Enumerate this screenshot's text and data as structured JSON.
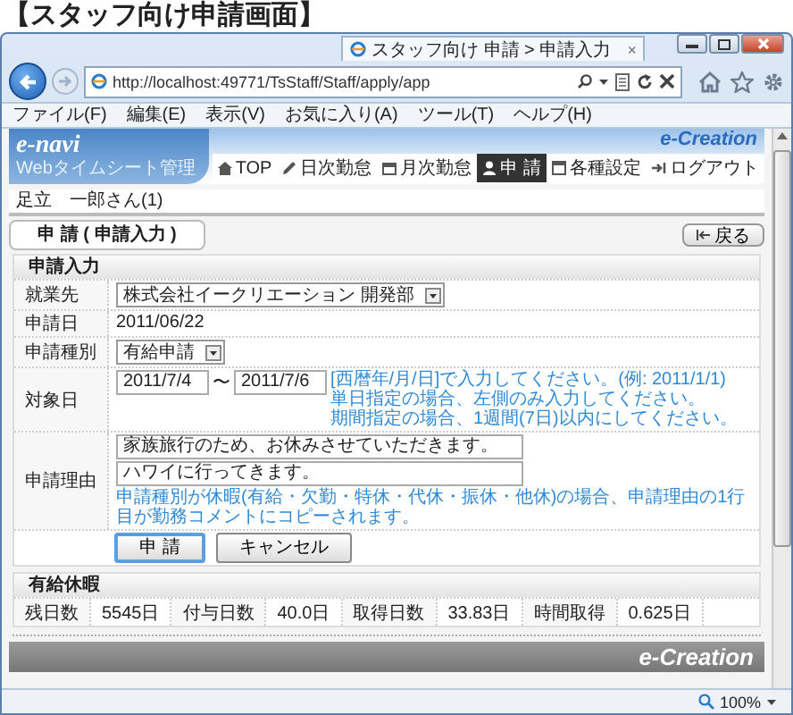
{
  "heading": "【スタッフ向け申請画面】",
  "browser": {
    "address": "http://localhost:49771/TsStaff/Staff/apply/app",
    "tab": "スタッフ向け 申請 > 申請入力",
    "tab_close": "×",
    "menu": [
      "ファイル(F)",
      "編集(E)",
      "表示(V)",
      "お気に入り(A)",
      "ツール(T)",
      "ヘルプ(H)"
    ],
    "zoom": "100%"
  },
  "site": {
    "logo": "e-navi",
    "logo_sub": "Webタイムシート管理",
    "brand": "e-Creation",
    "nav": [
      {
        "label": "TOP",
        "selected": false
      },
      {
        "label": "日次勤怠",
        "selected": false
      },
      {
        "label": "月次勤怠",
        "selected": false
      },
      {
        "label": "申 請",
        "selected": true
      },
      {
        "label": "各種設定",
        "selected": false
      },
      {
        "label": "ログアウト",
        "selected": false
      }
    ]
  },
  "user": "足立　一郎さん(1)",
  "page_title": "申 請 ( 申請入力 )",
  "back_button": "戻る",
  "form": {
    "title": "申請入力",
    "rows": [
      {
        "kind": "select",
        "label": "就業先",
        "value": "株式会社イークリエーション 開発部"
      },
      {
        "kind": "text",
        "label": "申請日",
        "value": "2011/06/22"
      },
      {
        "kind": "select",
        "label": "申請種別",
        "value": "有給申請"
      },
      {
        "kind": "range",
        "label": "対象日",
        "from": "2011/7/4",
        "separator": "〜",
        "to": "2011/7/6",
        "hints": [
          "[西暦年/月/日]で入力してください。(例: 2011/1/1)",
          "単日指定の場合、左側のみ入力してください。",
          "期間指定の場合、1週間(7日)以内にしてください。"
        ]
      },
      {
        "kind": "lines",
        "label": "申請理由",
        "values": [
          "家族旅行のため、お休みさせていただきます。",
          "ハワイに行ってきます。"
        ],
        "hint": "申請種別が休暇(有給・欠勤・特休・代休・振休・他休)の場合、申請理由の1行目が勤務コメントにコピーされます。"
      }
    ],
    "buttons": [
      "申 請",
      "キャンセル"
    ]
  },
  "leave": {
    "title": "有給休暇",
    "cells": [
      {
        "label": "残日数",
        "value": "5545日"
      },
      {
        "label": "付与日数",
        "value": "40.0日"
      },
      {
        "label": "取得日数",
        "value": "33.83日"
      },
      {
        "label": "時間取得",
        "value": "0.625日"
      }
    ]
  },
  "footer": {
    "brand": "e-Creation"
  }
}
